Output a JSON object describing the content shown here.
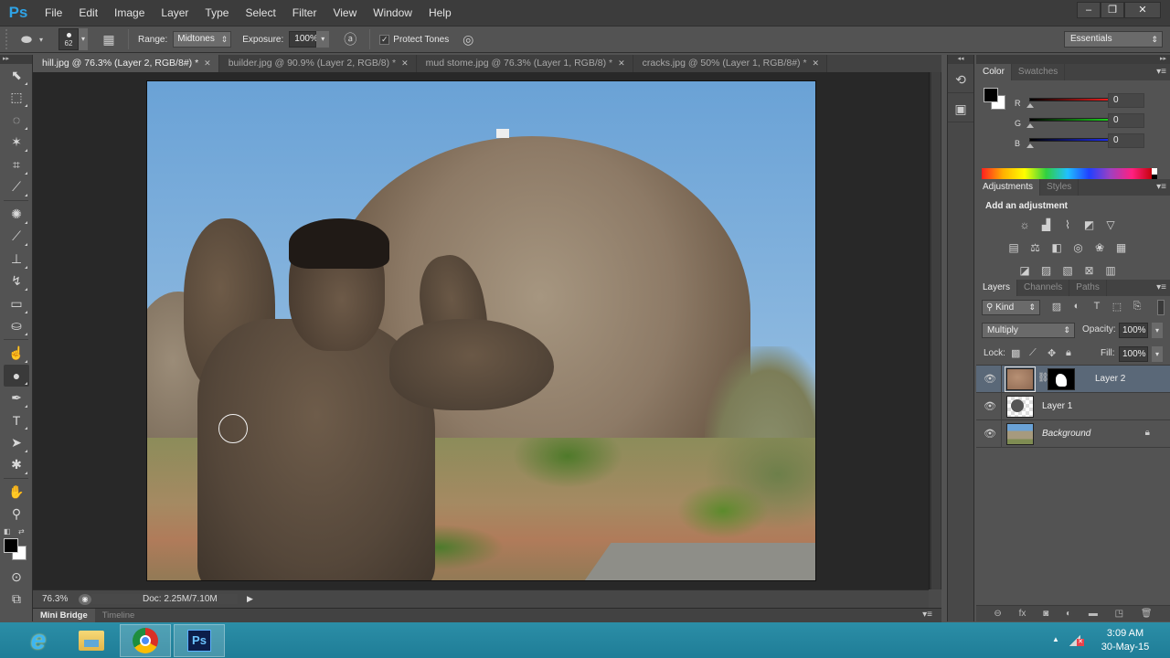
{
  "app": {
    "logo": "Ps",
    "menu": [
      "File",
      "Edit",
      "Image",
      "Layer",
      "Type",
      "Select",
      "Filter",
      "View",
      "Window",
      "Help"
    ],
    "window_controls": {
      "minimize": "–",
      "restore": "❐",
      "close": "✕"
    }
  },
  "options_bar": {
    "tool_icon": "burn-tool",
    "brush_size": "62",
    "range_label": "Range:",
    "range_value": "Midtones",
    "exposure_label": "Exposure:",
    "exposure_value": "100%",
    "protect_tones_label": "Protect Tones",
    "protect_tones_checked": true,
    "workspace": "Essentials"
  },
  "tabs": [
    {
      "label": "hill.jpg @ 76.3% (Layer 2, RGB/8#) *",
      "active": true
    },
    {
      "label": "builder.jpg @ 90.9% (Layer 2, RGB/8) *",
      "active": false
    },
    {
      "label": "mud stome.jpg @ 76.3% (Layer 1, RGB/8) *",
      "active": false
    },
    {
      "label": "cracks.jpg @ 50% (Layer 1, RGB/8#) *",
      "active": false
    }
  ],
  "tools": [
    "move-tool",
    "marquee-tool",
    "lasso-tool",
    "magic-wand-tool",
    "crop-tool",
    "eyedropper-tool",
    "spot-healing-tool",
    "brush-tool",
    "clone-stamp-tool",
    "history-brush-tool",
    "eraser-tool",
    "paint-bucket-tool",
    "blur-tool",
    "burn-tool",
    "pen-tool",
    "type-tool",
    "path-selection-tool",
    "custom-shape-tool",
    "hand-tool",
    "zoom-tool"
  ],
  "tool_glyphs": [
    "⬉",
    "⬚",
    "◌",
    "✶",
    "⌗",
    "⟋",
    "✺",
    "⟋",
    "⊥",
    "↯",
    "▭",
    "⛀",
    "☝",
    "●",
    "✒",
    "T",
    "➤",
    "✱",
    "✋",
    "⚲"
  ],
  "colors": {
    "foreground": "#000000",
    "background": "#ffffff",
    "selected_layer": "#5a6878",
    "taskbar": "#2589a2"
  },
  "status": {
    "zoom": "76.3%",
    "doc": "Doc: 2.25M/7.10M"
  },
  "bottom_panel": {
    "tabs": [
      "Mini Bridge",
      "Timeline"
    ]
  },
  "color_panel": {
    "tabs": [
      "Color",
      "Swatches"
    ],
    "channels": [
      {
        "label": "R",
        "value": "0",
        "gradient": "linear-gradient(90deg,#000,#ff2020)"
      },
      {
        "label": "G",
        "value": "0",
        "gradient": "linear-gradient(90deg,#000,#20e020)"
      },
      {
        "label": "B",
        "value": "0",
        "gradient": "linear-gradient(90deg,#000,#2030ff)"
      }
    ]
  },
  "adjustments_panel": {
    "tabs": [
      "Adjustments",
      "Styles"
    ],
    "title": "Add an adjustment",
    "rows": [
      [
        "brightness-contrast",
        "levels",
        "curves",
        "exposure",
        "vibrance"
      ],
      [
        "hue-saturation",
        "color-balance",
        "black-white",
        "photo-filter",
        "channel-mixer",
        "color-lookup"
      ],
      [
        "invert",
        "posterize",
        "threshold",
        "selective-color",
        "gradient-map"
      ]
    ],
    "glyphs": [
      [
        "☼",
        "▟",
        "⌇",
        "◩",
        "▽"
      ],
      [
        "▤",
        "⚖",
        "◧",
        "◎",
        "❀",
        "▦"
      ],
      [
        "◪",
        "▨",
        "▧",
        "⊠",
        "▥"
      ]
    ]
  },
  "layers_panel": {
    "tabs": [
      "Layers",
      "Channels",
      "Paths"
    ],
    "filter_kind": "Kind",
    "blend_mode": "Multiply",
    "opacity_label": "Opacity:",
    "opacity": "100%",
    "lock_label": "Lock:",
    "fill_label": "Fill:",
    "fill": "100%",
    "layers": [
      {
        "name": "Layer 2",
        "visible": true,
        "selected": true,
        "has_mask": true
      },
      {
        "name": "Layer 1",
        "visible": true,
        "selected": false,
        "has_mask": false
      },
      {
        "name": "Background",
        "visible": true,
        "selected": false,
        "locked": true
      }
    ],
    "footer_icons": [
      "link-icon",
      "fx-icon",
      "add-mask-icon",
      "adjustment-layer-icon",
      "group-icon",
      "new-layer-icon",
      "delete-icon"
    ],
    "footer_glyphs": [
      "⊖",
      "fx",
      "◙",
      "◐",
      "▬",
      "◳",
      "🗑"
    ]
  },
  "taskbar": {
    "apps": [
      "internet-explorer",
      "file-explorer",
      "chrome",
      "photoshop"
    ],
    "time": "3:09 AM",
    "date": "30-May-15"
  }
}
